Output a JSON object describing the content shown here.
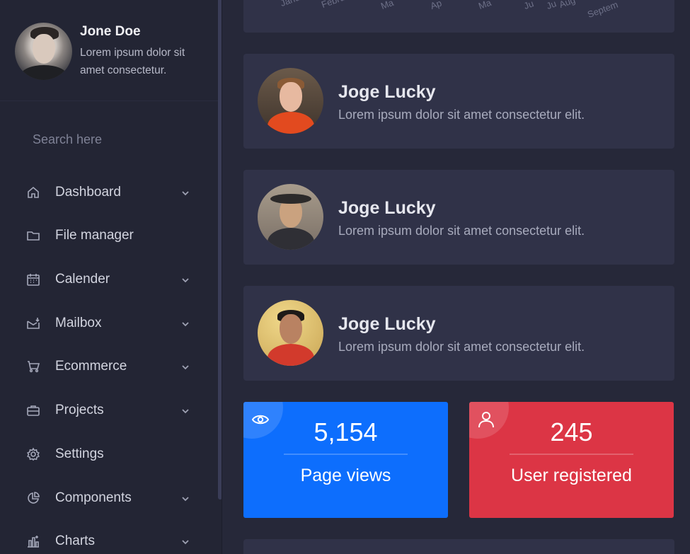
{
  "profile": {
    "name": "Jone Doe",
    "description": "Lorem ipsum dolor sit amet consectetur."
  },
  "search": {
    "placeholder": "Search here",
    "value": ""
  },
  "nav": [
    {
      "label": "Dashboard",
      "icon": "home-icon",
      "has_chevron": true
    },
    {
      "label": "File manager",
      "icon": "folder-icon",
      "has_chevron": false
    },
    {
      "label": "Calender",
      "icon": "calendar-icon",
      "has_chevron": true
    },
    {
      "label": "Mailbox",
      "icon": "mailbox-icon",
      "has_chevron": true
    },
    {
      "label": "Ecommerce",
      "icon": "cart-icon",
      "has_chevron": true
    },
    {
      "label": "Projects",
      "icon": "briefcase-icon",
      "has_chevron": true
    },
    {
      "label": "Settings",
      "icon": "gear-icon",
      "has_chevron": false
    },
    {
      "label": "Components",
      "icon": "pie-icon",
      "has_chevron": true
    },
    {
      "label": "Charts",
      "icon": "bar-chart-icon",
      "has_chevron": true
    }
  ],
  "top_chart": {
    "months": [
      "Janu",
      "Febru",
      "Ma",
      "Ap",
      "Ma",
      "Ju",
      "Ju",
      "Aug",
      "Septem"
    ]
  },
  "people": [
    {
      "name": "Joge Lucky",
      "description": "Lorem ipsum dolor sit amet consectetur elit."
    },
    {
      "name": "Joge Lucky",
      "description": "Lorem ipsum dolor sit amet consectetur elit."
    },
    {
      "name": "Joge Lucky",
      "description": "Lorem ipsum dolor sit amet consectetur elit."
    }
  ],
  "stats": [
    {
      "value": "5,154",
      "label": "Page views",
      "icon": "eye-icon",
      "color": "#0d6efd"
    },
    {
      "value": "245",
      "label": "User registered",
      "icon": "user-icon",
      "color": "#dc3545"
    }
  ],
  "colors": {
    "background": "#262839",
    "sidebar": "#232534",
    "card": "#303248"
  }
}
